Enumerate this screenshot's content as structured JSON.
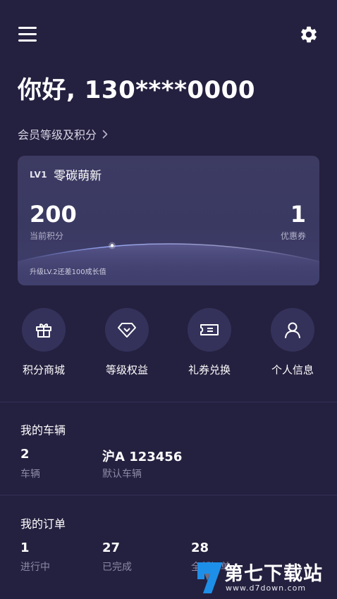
{
  "greeting": "你好, 130****0000",
  "member_link": "会员等级及积分",
  "card": {
    "level_badge": "LV1",
    "level_name": "零碳萌新",
    "points_value": "200",
    "points_label": "当前积分",
    "coupons_value": "1",
    "coupons_label": "优惠券",
    "upgrade_note": "升级LV.2还差100成长值"
  },
  "shortcuts": [
    {
      "label": "积分商城",
      "icon": "gift-icon"
    },
    {
      "label": "等级权益",
      "icon": "diamond-icon"
    },
    {
      "label": "礼券兑换",
      "icon": "ticket-icon"
    },
    {
      "label": "个人信息",
      "icon": "person-icon"
    }
  ],
  "vehicles": {
    "title": "我的车辆",
    "count_value": "2",
    "count_label": "车辆",
    "plate_value": "沪A 123456",
    "plate_label": "默认车辆"
  },
  "orders": {
    "title": "我的订单",
    "in_progress_value": "1",
    "in_progress_label": "进行中",
    "completed_value": "27",
    "completed_label": "已完成",
    "all_value": "28",
    "all_label": "全部订单"
  },
  "watermark": {
    "text": "第七下载站",
    "url": "www.d7down.com"
  },
  "colors": {
    "background": "#24203f",
    "card": "#3b3a63",
    "icon_circle": "#34325a",
    "secondary_text": "#8c8aa6",
    "watermark_blue": "#1e8fe8"
  }
}
